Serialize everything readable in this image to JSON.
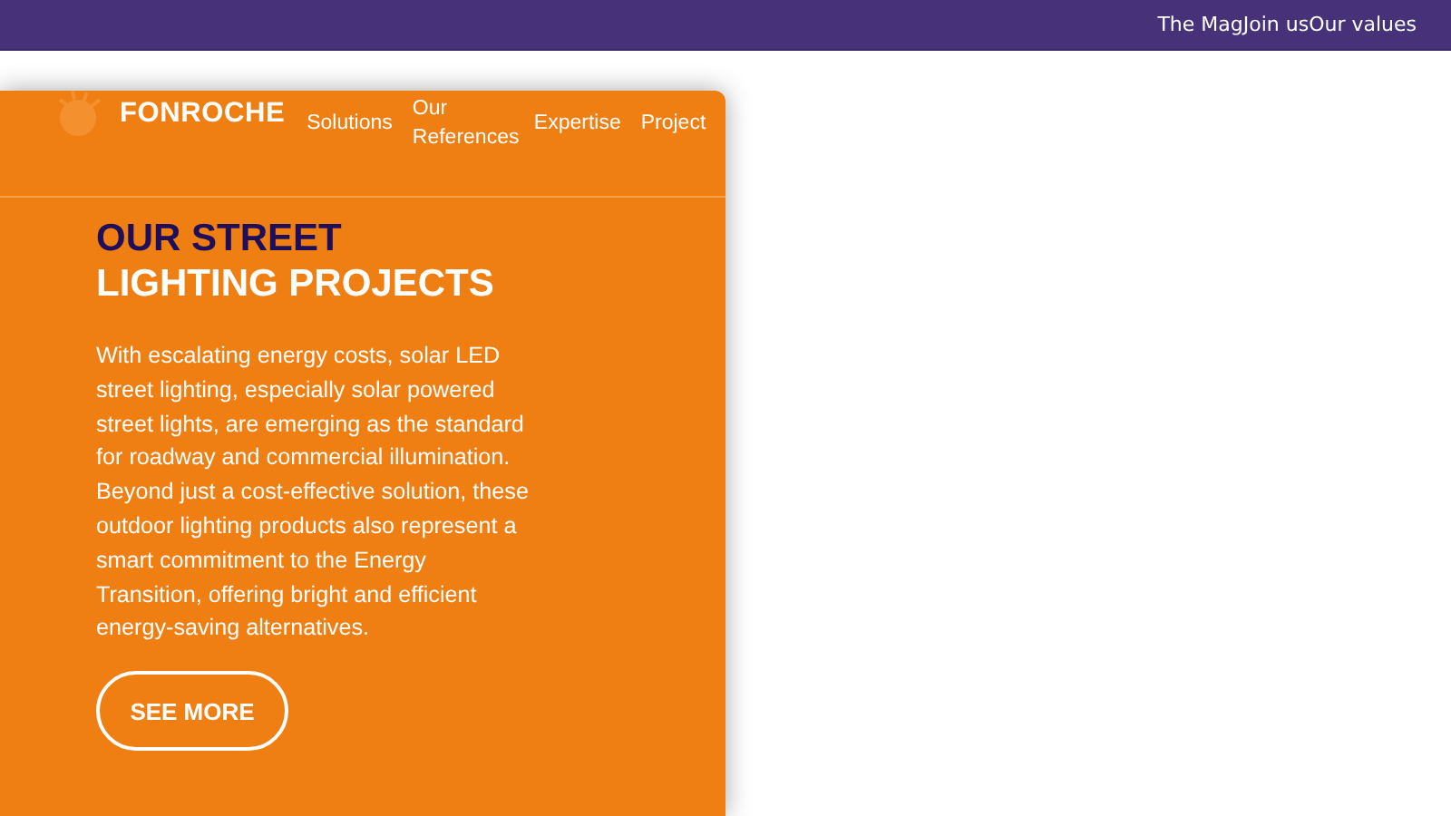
{
  "top_links": [
    "The Mag",
    "Join us",
    "Our values"
  ],
  "logo": {
    "text": "FONROCHE"
  },
  "nav": [
    "Solutions",
    "Our References",
    "Expertise",
    "Project"
  ],
  "heading": {
    "highlight": "OUR STREET",
    "rest": "LIGHTING PROJECTS"
  },
  "body": "With escalating energy costs, solar LED street lighting, especially solar powered street lights, are emerging as the standard for roadway and commercial illumination. Beyond just a cost-effective solution, these outdoor lighting products also represent a smart commitment to the Energy Transition, offering bright and efficient energy-saving alternatives.",
  "button": "SEE MORE"
}
